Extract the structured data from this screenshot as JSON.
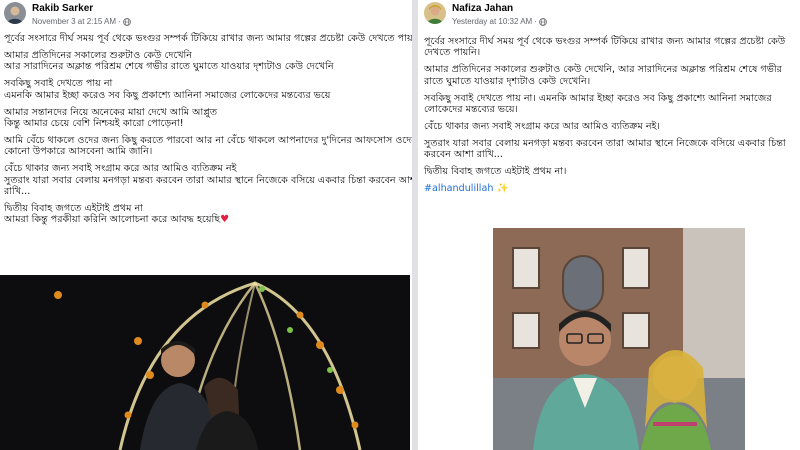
{
  "post_left": {
    "author": "Rakib Sarker",
    "timestamp": "November 3 at 2:15 AM",
    "dot": "·",
    "paragraphs": [
      [
        "পূর্বের সংসারে দীর্ঘ সময় পূর্ব থেকে ভংগুর সম্পর্ক টিকিয়ে রাখার জন্য আমার গল্পের প্রচেষ্টা কেউ দেখতে পায়নি"
      ],
      [
        "আমার প্রতিদিনের সকালের শুরুটাও কেউ দেখেনি",
        "আর সারাদিনের অক্লান্ত পরিশ্রম শেষে গভীর রাতে ঘুমাতে যাওয়ার দৃশ্যটাও কেউ দেখেনি"
      ],
      [
        "সবকিছু সবাই দেখতে পায় না",
        "এমনকি আমার ইচ্ছা করেও সব কিছু প্রকাশ্যে আনিনা সমাজের লোকেদের মন্তব্যের ভয়ে"
      ],
      [
        "আমার সন্তানদের নিয়ে অনেকের মায়া দেখে আমি আপ্লুত",
        "কিন্তু আমার চেয়ে বেশি নিশ্চয়ই কারো পোড়েনা!"
      ],
      [
        "আমি বেঁচে থাকলে ওদের জন্য কিছু করতে পারবো আর না বেঁচে থাকলে আপনাদের দু'দিনের আফসোস ওদের",
        "কোনো উপকারে আসবেনা আমি জানি।"
      ],
      [
        "বেঁচে থাকার জন্য সবাই সংগ্রাম করে আর আমিও ব্যতিক্রম নই",
        "সুতরাং যারা সবার বেলায় মনগড়া মন্তব্য করবেন তারা আমার স্থানে নিজেকে বসিয়ে একবার চিন্তা করবেন আশা",
        "রাখি..."
      ],
      [
        "দ্বিতীয় বিবাহ জগতে এইটাই প্রথম না",
        "আমরা কিন্তু পরকীয়া করিনি আলোচনা করে আবদ্ধ হয়েছি"
      ]
    ],
    "heart": "♥"
  },
  "post_right": {
    "author": "Nafiza Jahan",
    "timestamp": "Yesterday at 10:32 AM",
    "dot": "·",
    "paragraphs": [
      "পূর্বের সংসারে দীর্ঘ সময় পূর্ব থেকে ভংগুর সম্পর্ক টিকিয়ে রাখার জন্য আমার গল্পের প্রচেষ্টা কেউ দেখতে পায়নি।",
      "আমার প্রতিদিনের সকালের শুরুটাও কেউ দেখেনি, আর সারাদিনের অক্লান্ত পরিশ্রম শেষে গভীর রাতে ঘুমাতে যাওয়ার দৃশ্যটাও কেউ দেখেনি।",
      "সবকিছু সবাই দেখতে পায় না। এমনকি আমার ইচ্ছা করেও সব কিছু প্রকাশ্যে আনিনা সমাজের লোকেদের মন্তব্যের ভয়ে।",
      "বেঁচে থাকার জন্য সবাই সংগ্রাম করে আর আমিও ব্যতিক্রম নই।",
      "সুতরাং যারা সবার বেলায় মনগড়া মন্তব্য করবেন তারা আমার স্থানে নিজেকে বসিয়ে একবার চিন্তা করবেন আশা রাখি...",
      "দ্বিতীয় বিবাহ জগতে এইটাই প্রথম না।"
    ],
    "hashtag": "#alhandulillah",
    "sparkle": "✨"
  }
}
